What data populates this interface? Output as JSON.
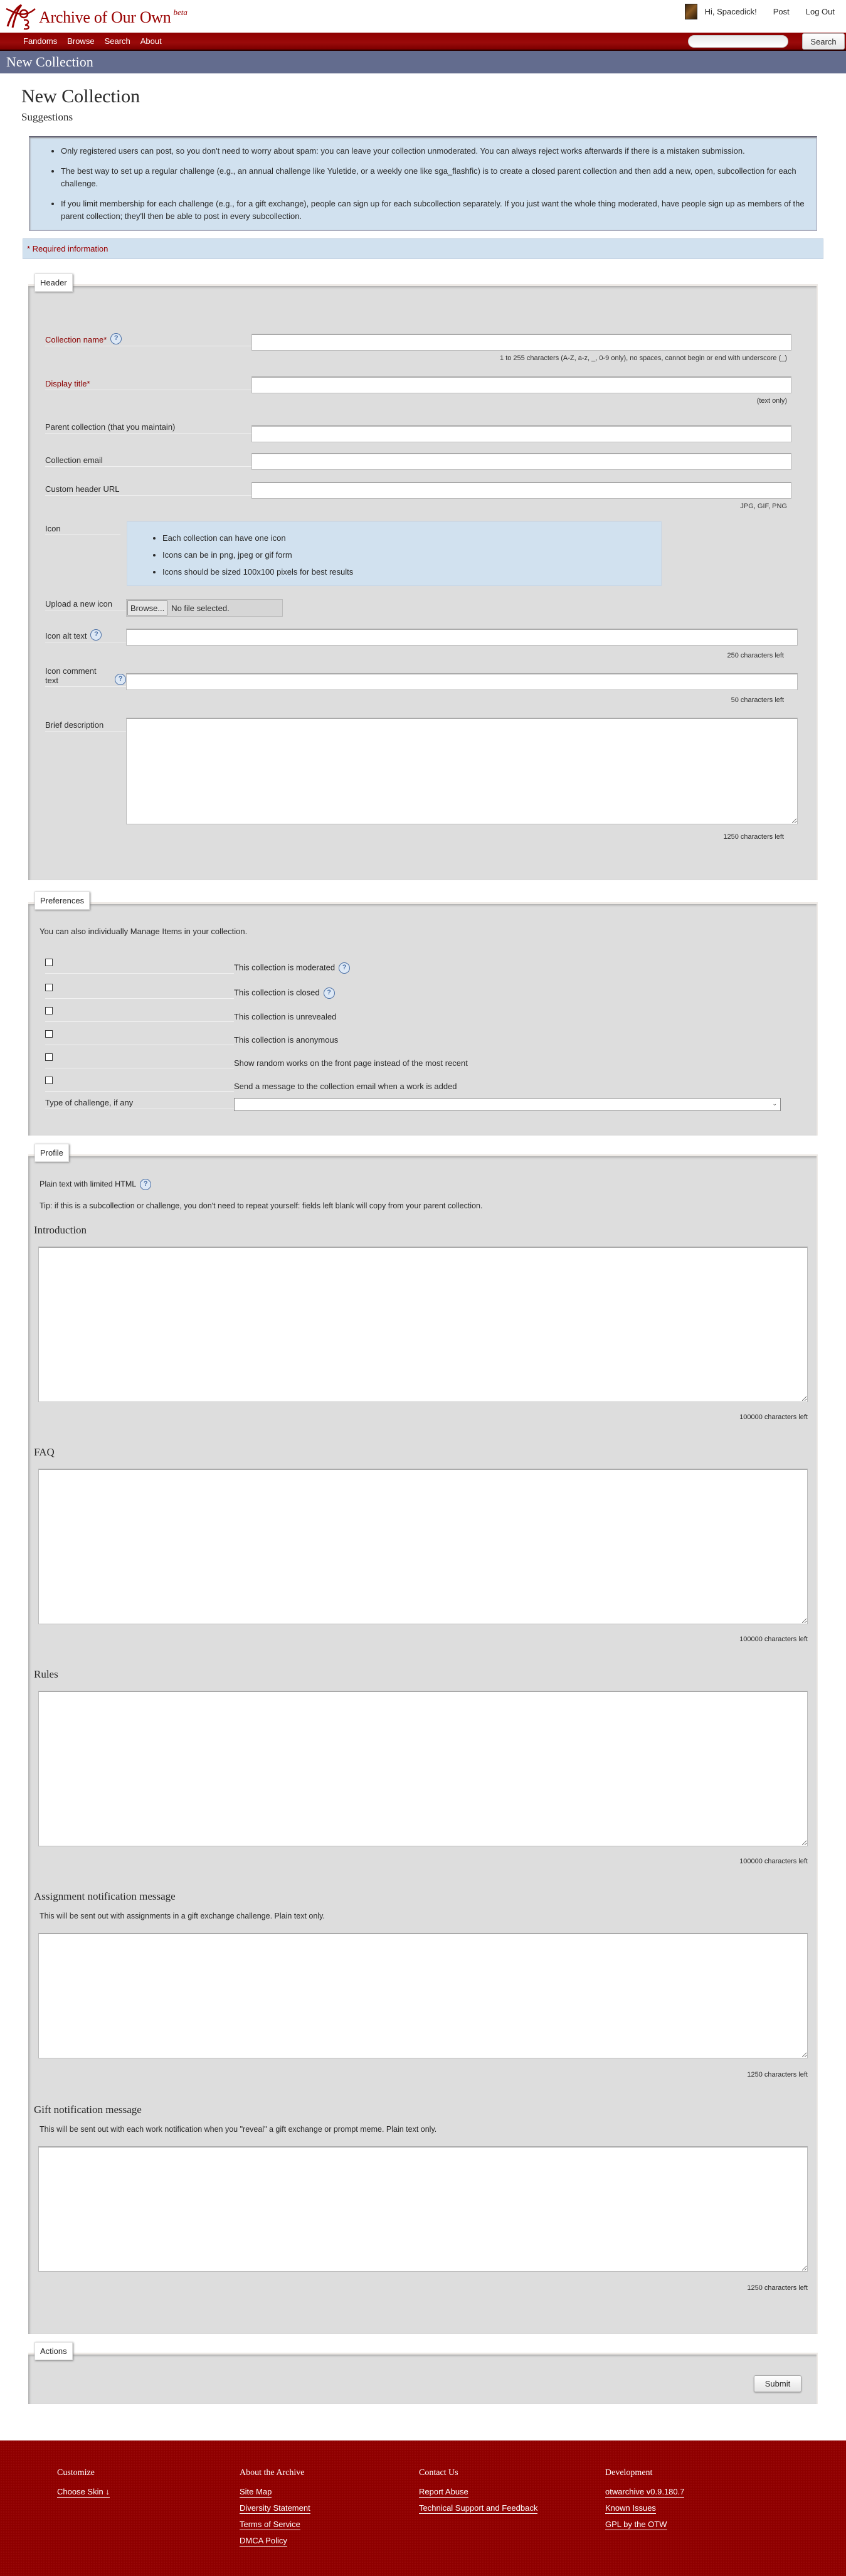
{
  "header": {
    "site_name": "Archive of Our Own",
    "beta_tag": "beta",
    "greeting": "Hi, Spacedick!",
    "post_link": "Post",
    "logout_link": "Log Out"
  },
  "nav": {
    "items": [
      "Fandoms",
      "Browse",
      "Search",
      "About"
    ],
    "search_value": "",
    "search_button": "Search"
  },
  "banner": {
    "title": "New Collection"
  },
  "page": {
    "title": "New Collection",
    "subtitle": "Suggestions",
    "suggestions": [
      "Only registered users can post, so you don't need to worry about spam: you can leave your collection unmoderated. You can always reject works afterwards if there is a mistaken submission.",
      "The best way to set up a regular challenge (e.g., an annual challenge like Yuletide, or a weekly one like sga_flashfic) is to create a closed parent collection and then add a new, open, subcollection for each challenge.",
      "If you limit membership for each challenge (e.g., for a gift exchange), people can sign up for each subcollection separately. If you just want the whole thing moderated, have people sign up as members of the parent collection; they'll then be able to post in every subcollection."
    ],
    "required_notice": "* Required information"
  },
  "header_section": {
    "legend": "Header",
    "collection_name_label": "Collection name*",
    "collection_name_value": "",
    "collection_name_hint": "1 to 255 characters (A-Z, a-z, _, 0-9 only), no spaces, cannot begin or end with underscore (_)",
    "display_title_label": "Display title*",
    "display_title_value": "",
    "display_title_hint": "(text only)",
    "parent_label": "Parent collection (that you maintain)",
    "parent_value": "",
    "email_label": "Collection email",
    "email_value": "",
    "header_url_label": "Custom header URL",
    "header_url_value": "",
    "header_url_hint": "JPG, GIF, PNG",
    "icon_label": "Icon",
    "icon_notes": [
      "Each collection can have one icon",
      "Icons can be in png, jpeg or gif form",
      "Icons should be sized 100x100 pixels for best results"
    ],
    "upload_label": "Upload a new icon",
    "browse_button": "Browse...",
    "no_file": "No file selected.",
    "alt_text_label": "Icon alt text",
    "alt_text_value": "",
    "alt_text_left": "250 characters left",
    "comment_label": "Icon comment text",
    "comment_value": "",
    "comment_left": "50 characters left",
    "description_label": "Brief description",
    "description_value": "",
    "description_left": "1250 characters left"
  },
  "preferences": {
    "legend": "Preferences",
    "intro": "You can also individually Manage Items in your collection.",
    "options": [
      {
        "label": "This collection is moderated",
        "checked": false,
        "help": true
      },
      {
        "label": "This collection is closed",
        "checked": false,
        "help": true
      },
      {
        "label": "This collection is unrevealed",
        "checked": false,
        "help": false
      },
      {
        "label": "This collection is anonymous",
        "checked": false,
        "help": false
      },
      {
        "label": "Show random works on the front page instead of the most recent",
        "checked": false,
        "help": false
      },
      {
        "label": "Send a message to the collection email when a work is added",
        "checked": false,
        "help": false
      }
    ],
    "challenge_label": "Type of challenge, if any",
    "challenge_value": ""
  },
  "profile": {
    "legend": "Profile",
    "html_note": "Plain text with limited HTML",
    "tip": "Tip: if this is a subcollection or challenge, you don't need to repeat yourself: fields left blank will copy from your parent collection.",
    "intro_heading": "Introduction",
    "intro_left": "100000 characters left",
    "faq_heading": "FAQ",
    "faq_left": "100000 characters left",
    "rules_heading": "Rules",
    "rules_left": "100000 characters left",
    "assignment_heading": "Assignment notification message",
    "assignment_note": "This will be sent out with assignments in a gift exchange challenge. Plain text only.",
    "assignment_left": "1250 characters left",
    "gift_heading": "Gift notification message",
    "gift_note": "This will be sent out with each work notification when you \"reveal\" a gift exchange or prompt meme. Plain text only.",
    "gift_left": "1250 characters left"
  },
  "actions": {
    "legend": "Actions",
    "submit": "Submit"
  },
  "footer": {
    "columns": [
      {
        "heading": "Customize",
        "links": [
          "Choose Skin ↓"
        ]
      },
      {
        "heading": "About the Archive",
        "links": [
          "Site Map",
          "Diversity Statement",
          "Terms of Service",
          "DMCA Policy"
        ]
      },
      {
        "heading": "Contact Us",
        "links": [
          "Report Abuse",
          "Technical Support and Feedback"
        ]
      },
      {
        "heading": "Development",
        "links": [
          "otwarchive v0.9.180.7",
          "Known Issues",
          "GPL by the OTW"
        ]
      }
    ]
  },
  "colors": {
    "brand_red": "#990000",
    "banner": "#636c8e",
    "notice_blue": "#d1e1ef",
    "fieldset_gray": "#dddddd"
  }
}
